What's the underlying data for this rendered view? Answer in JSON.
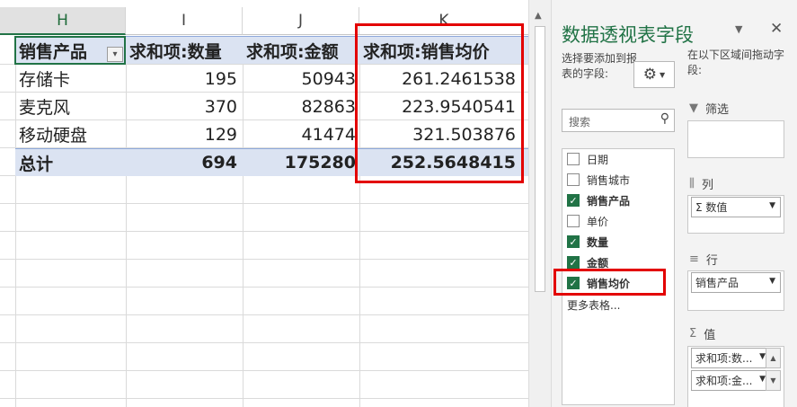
{
  "sheet": {
    "columns": [
      "H",
      "I",
      "J",
      "K"
    ],
    "header_row": [
      "销售产品",
      "求和项:数量",
      "求和项:金额",
      "求和项:销售均价"
    ],
    "rows": [
      [
        "存储卡",
        "195",
        "50943",
        "261.2461538"
      ],
      [
        "麦克风",
        "370",
        "82863",
        "223.9540541"
      ],
      [
        "移动硬盘",
        "129",
        "41474",
        "321.503876"
      ]
    ],
    "total_row": [
      "总计",
      "694",
      "175280",
      "252.5648415"
    ]
  },
  "pane": {
    "title": "数据透视表字段",
    "choose_label": "选择要添加到报表的字段:",
    "drag_label": "在以下区域间拖动字段:",
    "search_placeholder": "搜索",
    "fields": [
      {
        "label": "日期",
        "checked": false
      },
      {
        "label": "销售城市",
        "checked": false
      },
      {
        "label": "销售产品",
        "checked": true
      },
      {
        "label": "单价",
        "checked": false
      },
      {
        "label": "数量",
        "checked": true
      },
      {
        "label": "金额",
        "checked": true
      },
      {
        "label": "销售均价",
        "checked": true
      }
    ],
    "more_tables": "更多表格...",
    "areas": {
      "filters": {
        "label": "筛选",
        "icon": "filter-icon"
      },
      "columns": {
        "label": "列",
        "icon": "columns-icon",
        "chip": "Σ  数值"
      },
      "rows": {
        "label": "行",
        "icon": "rows-icon",
        "chip": "销售产品"
      },
      "values": {
        "label": "值",
        "icon": "sigma-icon",
        "chips": [
          "求和项:数...",
          "求和项:金..."
        ]
      }
    }
  },
  "colors": {
    "accent": "#217346",
    "pivot_header": "#dbe3f2",
    "highlight": "#e30000"
  }
}
